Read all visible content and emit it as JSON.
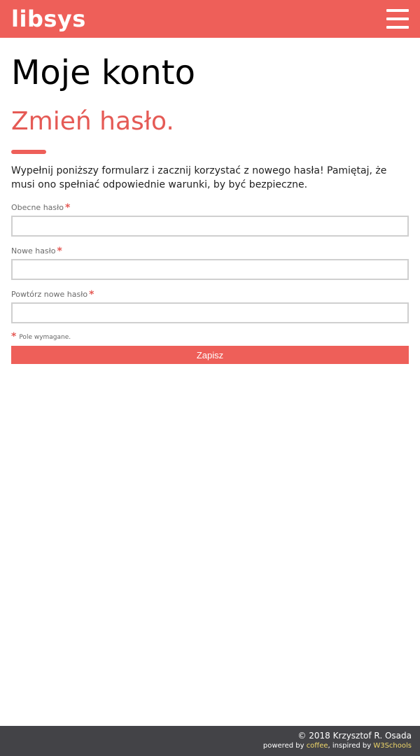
{
  "header": {
    "brand": "libsys",
    "menu_icon": "hamburger-icon",
    "background": "#ee5f59"
  },
  "main": {
    "page_title": "Moje konto",
    "section_title": "Zmień hasło.",
    "intro": "Wypełnij poniższy formularz i zacznij korzystać z nowego hasła! Pamiętaj, że musi ono spełniać odpowiednie warunki, by być bezpieczne.",
    "fields": [
      {
        "label": "Obecne hasło",
        "required_mark": "*",
        "value": ""
      },
      {
        "label": "Nowe hasło",
        "required_mark": "*",
        "value": ""
      },
      {
        "label": "Powtórz nowe hasło",
        "required_mark": "*",
        "value": ""
      }
    ],
    "required_note": {
      "mark": "*",
      "text": "Pole wymagane."
    },
    "submit_label": "Zapisz",
    "accent_color": "#e55a55"
  },
  "footer": {
    "copyright": "© 2018 Krzysztof R. Osada",
    "powered_prefix": "powered by ",
    "powered_link": "coffee",
    "inspired_prefix": ", inspired by ",
    "inspired_link": "W3Schools",
    "background": "#434347",
    "link_color": "#f0d86a"
  }
}
